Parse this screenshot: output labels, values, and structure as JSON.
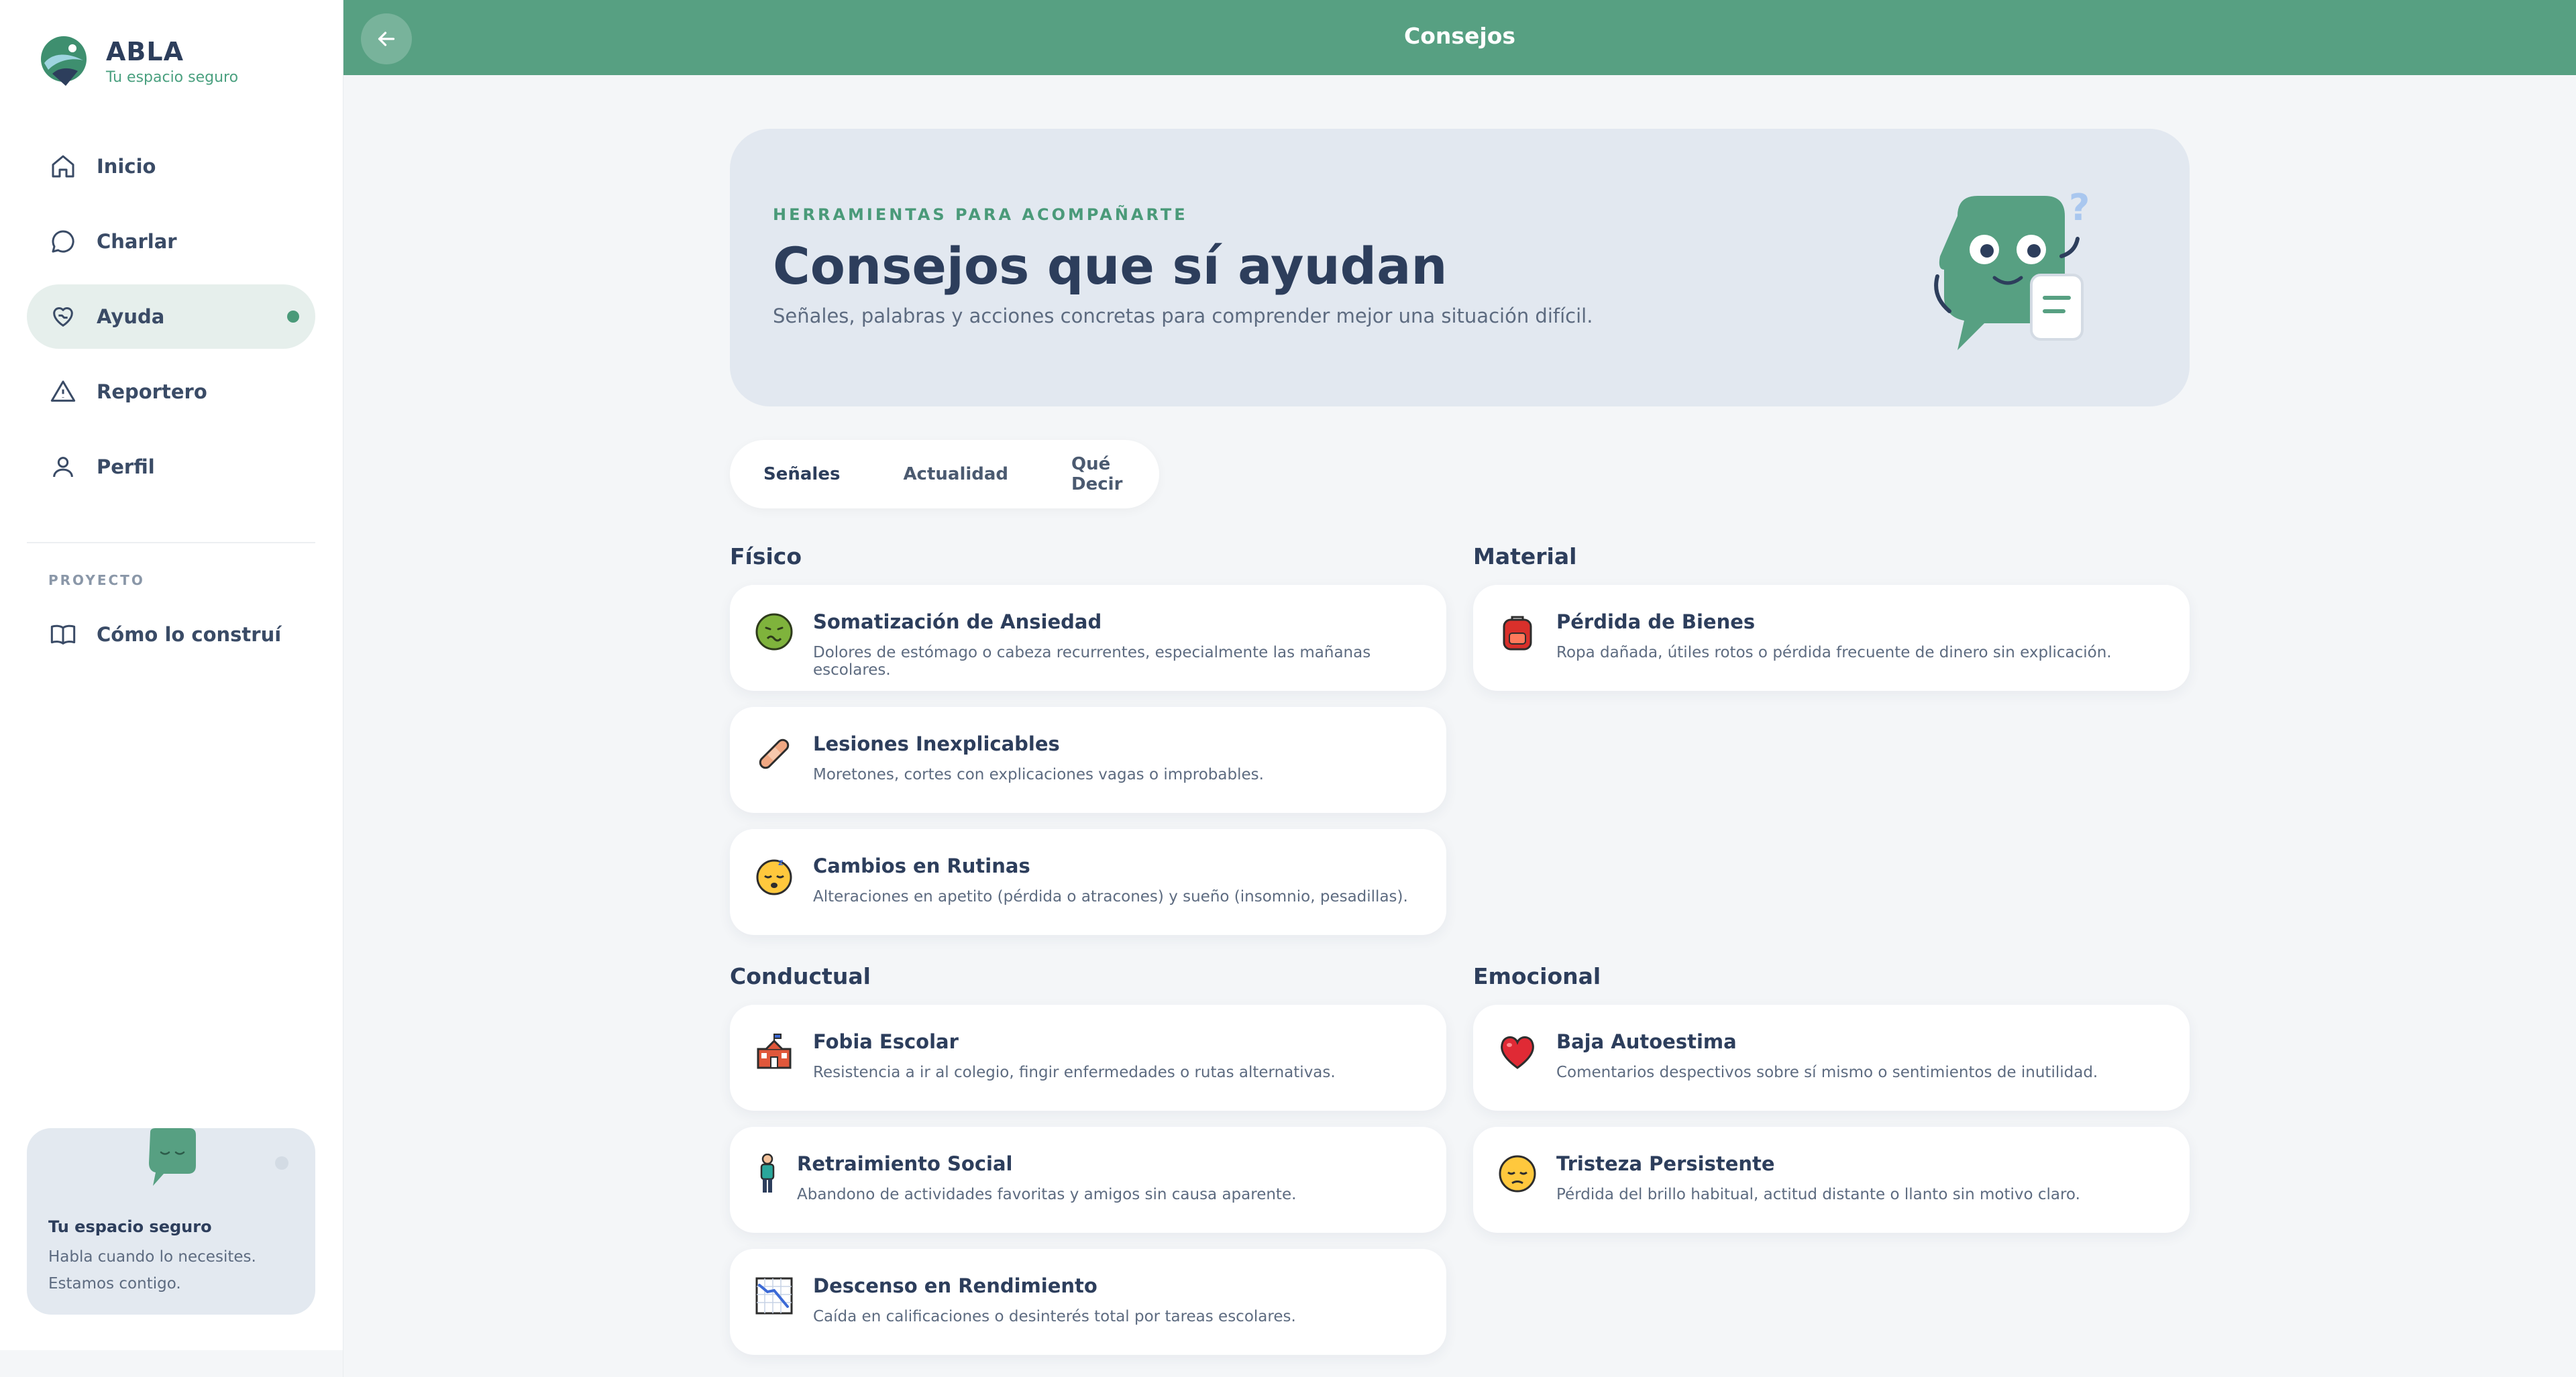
{
  "brand": {
    "name": "ABLA",
    "tagline": "Tu espacio seguro"
  },
  "nav": {
    "items": [
      {
        "label": "Inicio",
        "icon": "home-icon"
      },
      {
        "label": "Charlar",
        "icon": "chat-icon"
      },
      {
        "label": "Ayuda",
        "icon": "heart-hand-icon",
        "active": true
      },
      {
        "label": "Reportero",
        "icon": "warning-icon"
      },
      {
        "label": "Perfil",
        "icon": "user-icon"
      }
    ],
    "section_label": "PROYECTO",
    "build_label": "Cómo lo construí"
  },
  "safe_card": {
    "title": "Tu espacio seguro",
    "text": "Habla cuando lo necesites. Estamos contigo."
  },
  "topbar": {
    "title": "Consejos"
  },
  "hero": {
    "eyebrow": "HERRAMIENTAS PARA ACOMPAÑARTE",
    "title": "Consejos que sí ayudan",
    "subtitle": "Señales, palabras y acciones concretas para comprender mejor una situación difícil."
  },
  "tabs": [
    {
      "label": "Señales",
      "active": true
    },
    {
      "label": "Actualidad"
    },
    {
      "label": "Qué Decir"
    }
  ],
  "categories": {
    "fisico": {
      "title": "Físico",
      "cards": [
        {
          "title": "Somatización de Ansiedad",
          "text": "Dolores de estómago o cabeza recurrentes, especialmente las mañanas escolares.",
          "icon": "nauseated-face-icon"
        },
        {
          "title": "Lesiones Inexplicables",
          "text": "Moretones, cortes con explicaciones vagas o improbables.",
          "icon": "bandage-icon"
        },
        {
          "title": "Cambios en Rutinas",
          "text": "Alteraciones en apetito (pérdida o atracones) y sueño (insomnio, pesadillas).",
          "icon": "sleeping-face-icon"
        }
      ]
    },
    "material": {
      "title": "Material",
      "cards": [
        {
          "title": "Pérdida de Bienes",
          "text": "Ropa dañada, útiles rotos o pérdida frecuente de dinero sin explicación.",
          "icon": "backpack-icon"
        }
      ]
    },
    "conductual": {
      "title": "Conductual",
      "cards": [
        {
          "title": "Fobia Escolar",
          "text": "Resistencia a ir al colegio, fingir enfermedades o rutas alternativas.",
          "icon": "school-icon"
        },
        {
          "title": "Retraimiento Social",
          "text": "Abandono de actividades favoritas y amigos sin causa aparente.",
          "icon": "person-standing-icon"
        },
        {
          "title": "Descenso en Rendimiento",
          "text": "Caída en calificaciones o desinterés total por tareas escolares.",
          "icon": "chart-decreasing-icon"
        }
      ]
    },
    "emocional": {
      "title": "Emocional",
      "cards": [
        {
          "title": "Baja Autoestima",
          "text": "Comentarios despectivos sobre sí mismo o sentimientos de inutilidad.",
          "icon": "red-heart-icon"
        },
        {
          "title": "Tristeza Persistente",
          "text": "Pérdida del brillo habitual, actitud distante o llanto sin motivo claro.",
          "icon": "pensive-face-icon"
        }
      ]
    }
  },
  "colors": {
    "accent": "#57a082",
    "navy": "#2d3e5c",
    "hero_bg": "#e2e8f0",
    "page_bg": "#f4f6f8"
  }
}
